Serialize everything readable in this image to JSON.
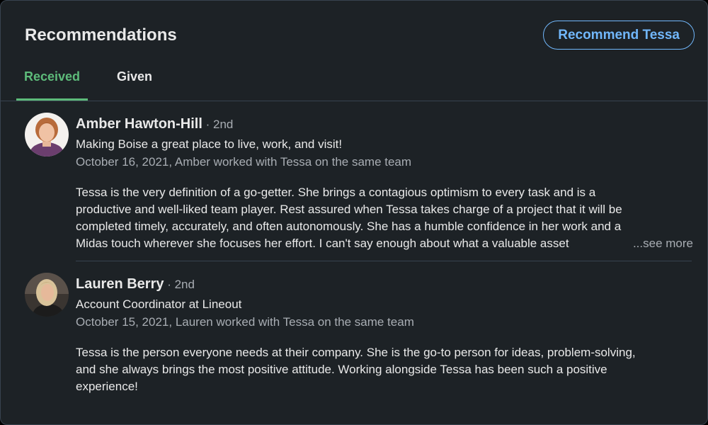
{
  "section": {
    "title": "Recommendations",
    "recommend_button": "Recommend Tessa"
  },
  "tabs": [
    {
      "label": "Received",
      "active": true
    },
    {
      "label": "Given",
      "active": false
    }
  ],
  "recommendations": [
    {
      "name": "Amber Hawton-Hill",
      "degree": " · 2nd",
      "headline": "Making Boise a great place to live, work, and visit!",
      "meta": "October 16, 2021, Amber worked with Tessa on the same team",
      "lines": [
        "Tessa is the very definition of a go-getter. She brings a contagious optimism to every task and is a",
        "productive and well-liked team player. Rest assured when Tessa takes charge of a project that it will be",
        "completed timely, accurately, and often autonomously. She has a humble confidence in her work and a",
        "Midas touch wherever she focuses her effort. I can't say enough about what a valuable asset"
      ],
      "see_more": "...see more"
    },
    {
      "name": "Lauren Berry",
      "degree": " · 2nd",
      "headline": "Account Coordinator at Lineout",
      "meta": "October 15, 2021, Lauren worked with Tessa on the same team",
      "lines": [
        "Tessa is the person everyone needs at their company. She is the go-to person for ideas, problem-solving,",
        "and she always brings the most positive attitude. Working alongside Tessa has been such a positive",
        "experience!"
      ]
    }
  ],
  "colors": {
    "background": "#1d2226",
    "accent_blue": "#71b7fb",
    "active_tab_green": "#5dbb7a",
    "muted_text": "#a8adb3"
  }
}
